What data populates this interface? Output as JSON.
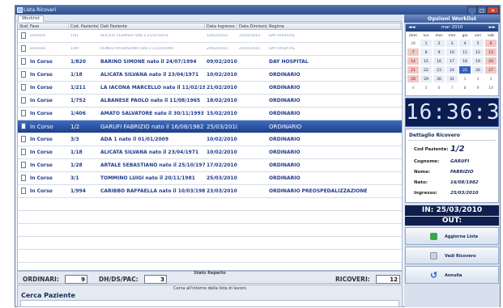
{
  "window": {
    "title": "Lista Ricoveri"
  },
  "tabs": [
    "Worklist"
  ],
  "columns": [
    "Stato",
    "Fase",
    "Cod. Paziente",
    "Dati Paziente",
    "Data Ingresso",
    "Data Dimissione",
    "Regime"
  ],
  "rows": [
    {
      "type": "done",
      "fase": "Dimesso",
      "cod": "1/01",
      "paziente": "ALICATA CELMISIA nato il 21/07/1976",
      "ingresso": "10/02/2010",
      "dimissione": "15/02/2010",
      "regime": "DAY HOSPITAL"
    },
    {
      "type": "done",
      "fase": "Dimesso",
      "cod": "1/00",
      "paziente": "ROMEO PROSPERINA nato il 11/10/1990",
      "ingresso": "20/02/2010",
      "dimissione": "25/02/2010",
      "regime": "DAY HOSPITAL"
    },
    {
      "type": "act",
      "fase": "In Corso",
      "cod": "1/820",
      "paziente": "BARINO SIMONE nato il 24/07/1994",
      "ingresso": "09/02/2010",
      "dimissione": "",
      "regime": "DAY HOSPITAL"
    },
    {
      "type": "act",
      "fase": "In Corso",
      "cod": "1/18",
      "paziente": "ALICATA SILVANA nato il 23/04/1971",
      "ingresso": "10/02/2010",
      "dimissione": "",
      "regime": "ORDINARIO"
    },
    {
      "type": "act",
      "fase": "In Corso",
      "cod": "1/211",
      "paziente": "LA IACONA MARCELLO nato il 11/02/19...",
      "ingresso": "21/02/2010",
      "dimissione": "",
      "regime": "ORDINARIO"
    },
    {
      "type": "act",
      "fase": "In Corso",
      "cod": "1/752",
      "paziente": "ALBANESE PAOLO nato il 11/08/1965",
      "ingresso": "18/02/2010",
      "dimissione": "",
      "regime": "ORDINARIO"
    },
    {
      "type": "act",
      "fase": "In Corso",
      "cod": "1/406",
      "paziente": "AMATO SALVATORE nato il 30/11/1993",
      "ingresso": "15/02/2010",
      "dimissione": "",
      "regime": "ORDINARIO"
    },
    {
      "type": "sel",
      "fase": "In Corso",
      "cod": "1/2",
      "paziente": "GARUFI FABRIZIO nato il 16/08/1982",
      "ingresso": "25/03/2010",
      "dimissione": "",
      "regime": "ORDINARIO"
    },
    {
      "type": "act",
      "fase": "In Corso",
      "cod": "3/3",
      "paziente": "ADA 1 nato il 01/01/2009",
      "ingresso": "10/02/2010",
      "dimissione": "",
      "regime": "ORDINARIO"
    },
    {
      "type": "act",
      "fase": "In Corso",
      "cod": "1/18",
      "paziente": "ALICATA SILVANA nato il 23/04/1971",
      "ingresso": "10/02/2010",
      "dimissione": "",
      "regime": "ORDINARIO"
    },
    {
      "type": "act",
      "fase": "In Corso",
      "cod": "1/28",
      "paziente": "ARTALE SEBASTIANO nato il 25/10/1978",
      "ingresso": "17/02/2010",
      "dimissione": "",
      "regime": "ORDINARIO"
    },
    {
      "type": "act",
      "fase": "In Corso",
      "cod": "3/1",
      "paziente": "TOMMINO LUIGI nato il 20/11/1981",
      "ingresso": "25/03/2010",
      "dimissione": "",
      "regime": "ORDINARIO"
    },
    {
      "type": "act",
      "fase": "In Corso",
      "cod": "1/994",
      "paziente": "CARIBBO RAFFAELLA nato il 10/03/1986",
      "ingresso": "23/03/2010",
      "dimissione": "",
      "regime": "ORDINARIO PREOSPEDALIZZAZIONE"
    }
  ],
  "stato": {
    "label": "Stato Reparto",
    "ordinari_label": "ORDINARI:",
    "ordinari": "9",
    "dh_label": "DH/DS/PAC:",
    "dh": "3",
    "ricoveri_label": "RICOVERI:",
    "ricoveri": "12"
  },
  "search": {
    "hint": "Cerca all'interno della lista di lavoro",
    "title": "Cerca Paziente"
  },
  "options": {
    "title": "Opzioni Worklist",
    "calendar": {
      "month": "mar 2010",
      "nav_prev": "◄◄",
      "nav_next": "►►",
      "days": [
        "dom",
        "lun",
        "mar",
        "mer",
        "gio",
        "ven",
        "sab"
      ],
      "cells": [
        "28",
        "1",
        "2",
        "3",
        "4",
        "5",
        "6",
        "7",
        "8",
        "9",
        "10",
        "11",
        "12",
        "13",
        "14",
        "15",
        "16",
        "17",
        "18",
        "19",
        "20",
        "21",
        "22",
        "23",
        "24",
        "25",
        "26",
        "27",
        "28",
        "29",
        "30",
        "31",
        "1",
        "2",
        "3",
        "4",
        "5",
        "6",
        "7",
        "8",
        "9",
        "10"
      ],
      "today": "25"
    },
    "clock": "16:36:32"
  },
  "dettaglio": {
    "title": "Dettaglio Ricovero",
    "cod_label": "Cod Paziente:",
    "cod": "1/2",
    "cognome_label": "Cognome:",
    "cognome": "GARUFI",
    "nome_label": "Nome:",
    "nome": "FABRIZIO",
    "nato_label": "Nato:",
    "nato": "16/08/1982",
    "ingresso_label": "Ingresso:",
    "ingresso": "25/03/2010"
  },
  "in_out": {
    "in": "IN: 25/03/2010",
    "out": "OUT:"
  },
  "buttons": {
    "aggiorna": "Aggiorna Lista",
    "vedi": "Vedi Ricovero",
    "annulla": "Annulla"
  },
  "window_controls": {
    "min": "_",
    "max": "□",
    "close": "✕"
  }
}
